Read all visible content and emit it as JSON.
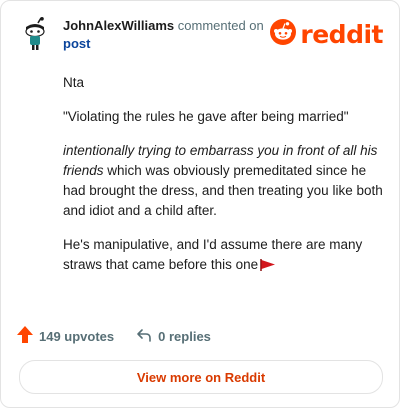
{
  "header": {
    "author": "JohnAlexWilliams",
    "commented_on": "commented on",
    "post_link": "post",
    "avatar_icon": "snoo-avatar-icon",
    "brand": {
      "logo_icon": "reddit-snoo-icon",
      "wordmark": "reddit",
      "color": "#ff4500"
    }
  },
  "comment": {
    "p1": "Nta",
    "p2": "\"Violating the rules he gave after being married\"",
    "p3_italic": "intentionally trying to embarrass you in front of all his friends",
    "p3_rest": " which was obviously premeditated since he had brought the dress, and then treating you like both and idiot and a child after.",
    "p4": "He's manipulative, and I'd assume there are many straws that came before this one",
    "flag_icon": "red-flag-icon"
  },
  "actions": {
    "upvotes_label": "149 upvotes",
    "upvote_icon": "upvote-arrow-icon",
    "replies_label": "0 replies",
    "reply_icon": "reply-arrow-icon"
  },
  "footer": {
    "view_more_label": "View more on Reddit"
  }
}
